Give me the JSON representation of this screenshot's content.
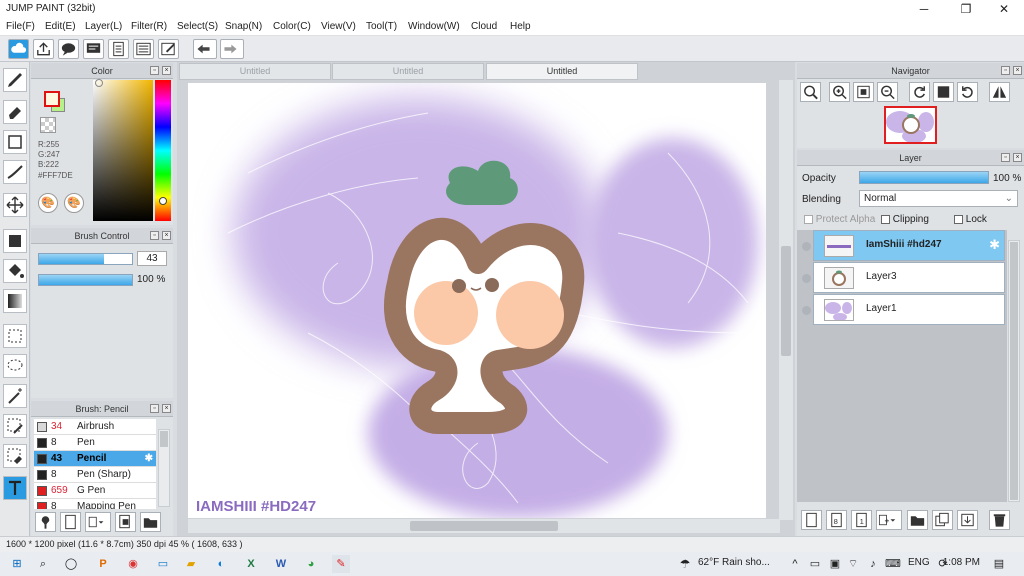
{
  "window": {
    "title": "JUMP PAINT (32bit)",
    "minimize": "─",
    "restore": "❐",
    "close": "✕"
  },
  "menu": [
    "File(F)",
    "Edit(E)",
    "Layer(L)",
    "Filter(R)",
    "Select(S)",
    "Snap(N)",
    "Color(C)",
    "View(V)",
    "Tool(T)",
    "Window(W)",
    "Cloud",
    "Help"
  ],
  "color_panel": {
    "title": "Color",
    "r": "R:255",
    "g": "G:247",
    "b": "B:222",
    "hex": "#FFF7DE",
    "main_color": "#FFF7DE"
  },
  "brush_control": {
    "title": "Brush Control",
    "size_value": "43",
    "size_fraction": 0.7,
    "opacity_value": "100 %",
    "opacity_fraction": 1.0
  },
  "brush_list": {
    "title": "Brush: Pencil",
    "items": [
      {
        "size": "34",
        "name": "Airbrush",
        "swatch": "#d8d8d8",
        "size_color": "#d23"
      },
      {
        "size": "8",
        "name": "Pen",
        "swatch": "#222222",
        "size_color": "#222"
      },
      {
        "size": "43",
        "name": "Pencil",
        "swatch": "#222222",
        "size_color": "#d23"
      },
      {
        "size": "8",
        "name": "Pen (Sharp)",
        "swatch": "#222222",
        "size_color": "#222"
      },
      {
        "size": "659",
        "name": "G Pen",
        "swatch": "#e02020",
        "size_color": "#d23"
      },
      {
        "size": "8",
        "name": "Mapping Pen",
        "swatch": "#e02020",
        "size_color": "#222"
      }
    ]
  },
  "tabs": [
    "Untitled",
    "Untitled",
    "Untitled"
  ],
  "canvas": {
    "watermark": "IAMSHIII #HD247"
  },
  "navigator": {
    "title": "Navigator"
  },
  "layer_panel": {
    "title": "Layer",
    "opacity_label": "Opacity",
    "opacity_value": "100 %",
    "opacity_fraction": 1.0,
    "blending_label": "Blending",
    "blending_value": "Normal",
    "protect_alpha": "Protect Alpha",
    "clipping": "Clipping",
    "lock": "Lock",
    "layers": [
      {
        "name": "IamShiii #hd247",
        "selected": true
      },
      {
        "name": "Layer3",
        "selected": false
      },
      {
        "name": "Layer1",
        "selected": false
      }
    ]
  },
  "status": {
    "text": "1600 * 1200 pixel  (11.6 * 8.7cm)  350 dpi  45 %  ( 1608, 633 )"
  },
  "taskbar": {
    "weather": "62°F  Rain sho...",
    "lang": "ENG",
    "time": "1:08 PM"
  }
}
